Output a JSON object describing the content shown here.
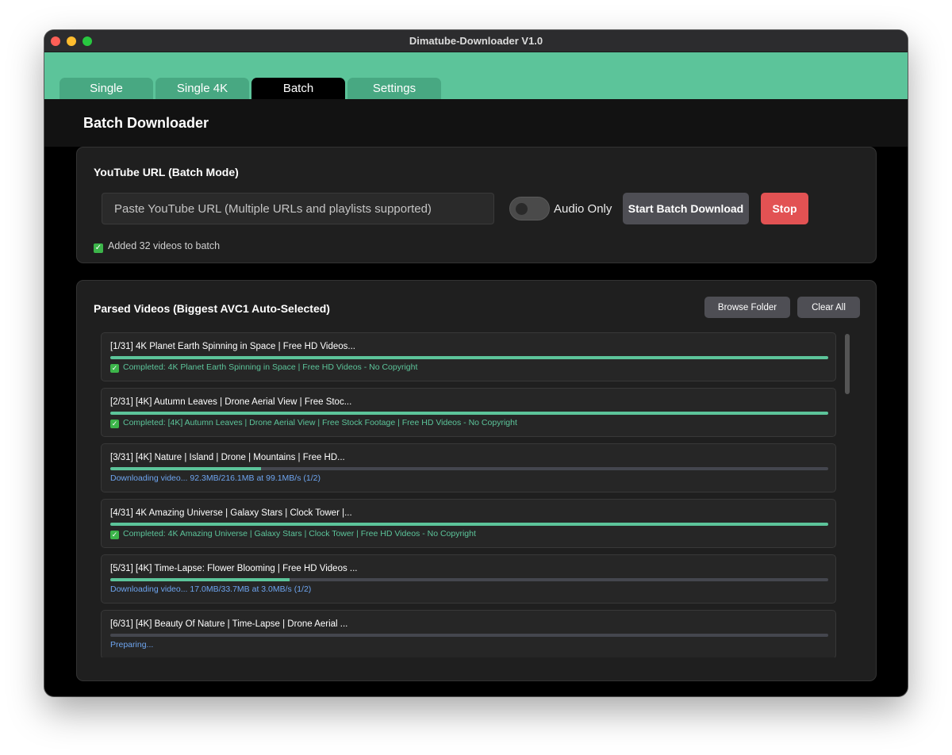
{
  "window": {
    "title": "Dimatube-Downloader V1.0"
  },
  "tabs": [
    {
      "label": "Single",
      "active": false
    },
    {
      "label": "Single 4K",
      "active": false
    },
    {
      "label": "Batch",
      "active": true
    },
    {
      "label": "Settings",
      "active": false
    }
  ],
  "header": {
    "title": "Batch Downloader"
  },
  "url_card": {
    "title": "YouTube URL (Batch Mode)",
    "input_value": "",
    "input_placeholder": "Paste YouTube URL (Multiple URLs and playlists supported)",
    "audio_only_label": "Audio Only",
    "audio_only_on": false,
    "start_label": "Start Batch Download",
    "stop_label": "Stop",
    "status": "Added 32 videos to batch"
  },
  "videos_card": {
    "title": "Parsed Videos (Biggest AVC1 Auto-Selected)",
    "browse_label": "Browse Folder",
    "clear_label": "Clear All",
    "items": [
      {
        "title": "[1/31] 4K Planet Earth Spinning in Space | Free HD Videos...",
        "progress": 1.0,
        "state": "done",
        "status": "Completed: 4K Planet Earth Spinning in Space | Free HD Videos - No Copyright"
      },
      {
        "title": "[2/31] [4K] Autumn Leaves | Drone Aerial View | Free Stoc...",
        "progress": 1.0,
        "state": "done",
        "status": "Completed: [4K] Autumn Leaves | Drone Aerial View | Free Stock Footage | Free HD Videos - No Copyright"
      },
      {
        "title": "[3/31] [4K] Nature | Island | Drone | Mountains | Free HD...",
        "progress": 0.21,
        "state": "downloading",
        "status": "Downloading video... 92.3MB/216.1MB at 99.1MB/s (1/2)"
      },
      {
        "title": "[4/31] 4K Amazing Universe | Galaxy Stars | Clock Tower |...",
        "progress": 1.0,
        "state": "done",
        "status": "Completed: 4K Amazing Universe | Galaxy Stars | Clock Tower | Free HD Videos - No Copyright"
      },
      {
        "title": "[5/31] [4K] Time-Lapse: Flower Blooming | Free HD Videos ...",
        "progress": 0.25,
        "state": "downloading",
        "status": "Downloading video... 17.0MB/33.7MB at 3.0MB/s (1/2)"
      },
      {
        "title": "[6/31] [4K] Beauty Of Nature | Time-Lapse | Drone Aerial ...",
        "progress": 0.0,
        "state": "preparing",
        "status": "Preparing..."
      }
    ]
  },
  "icons": {
    "check": "check-mark-icon",
    "check_glyph": "✓"
  }
}
